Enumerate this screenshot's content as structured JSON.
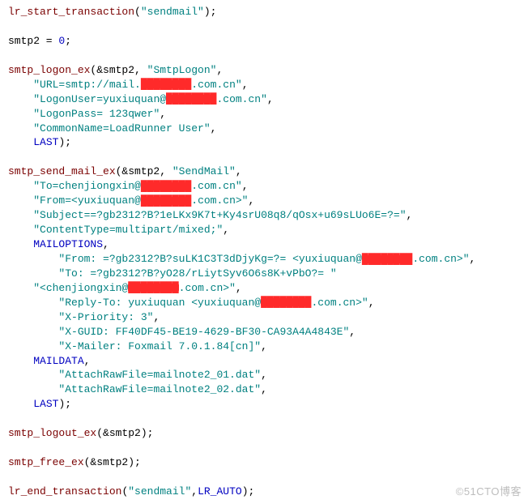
{
  "watermark": "©51CTO博客",
  "redacted": "████████",
  "code": {
    "l1_fn": "lr_start_transaction",
    "l1_str": "\"sendmail\"",
    "l3_lhs": "smtp2 = ",
    "l3_num": "0",
    "l5_fn": "smtp_logon_ex",
    "l5_args": "(&smtp2, ",
    "l5_str": "\"SmtpLogon\"",
    "l6_a": "\"URL=smtp://mail.",
    "l6_b": ".com.cn\"",
    "l7_a": "\"LogonUser=yuxiuquan@",
    "l7_b": ".com.cn\"",
    "l8": "\"LogonPass= 123qwer\"",
    "l9": "\"CommonName=LoadRunner User\"",
    "l10_kw": "LAST",
    "l12_fn": "smtp_send_mail_ex",
    "l12_args": "(&smtp2, ",
    "l12_str": "\"SendMail\"",
    "l13_a": "\"To=chenjiongxin@",
    "l13_b": ".com.cn\"",
    "l14_a": "\"From=<yuxiuquan@",
    "l14_b": ".com.cn>\"",
    "l15": "\"Subject==?gb2312?B?1eLKx9K7t+Ky4srU08q8/qOsx+u69sLUo6E=?=\"",
    "l16": "\"ContentType=multipart/mixed;\"",
    "l17_kw": "MAILOPTIONS",
    "l18_a": "\"From: =?gb2312?B?suLK1C3T3dDjyKg=?= <yuxiuquan@",
    "l18_b": ".com.cn>\"",
    "l19": "\"To: =?gb2312?B?yO28/rLiytSyv6O6s8K+vPbO?= \"",
    "l20_a": "\"<chenjiongxin@",
    "l20_b": ".com.cn>\"",
    "l21_a": "\"Reply-To: yuxiuquan <yuxiuquan@",
    "l21_b": ".com.cn>\"",
    "l22": "\"X-Priority: 3\"",
    "l23": "\"X-GUID: FF40DF45-BE19-4629-BF30-CA93A4A4843E\"",
    "l24": "\"X-Mailer: Foxmail 7.0.1.84[cn]\"",
    "l25_kw": "MAILDATA",
    "l26": "\"AttachRawFile=mailnote2_01.dat\"",
    "l27": "\"AttachRawFile=mailnote2_02.dat\"",
    "l28_kw": "LAST",
    "l30_fn": "smtp_logout_ex",
    "l30_args": "(&smtp2);",
    "l32_fn": "smtp_free_ex",
    "l32_args": "(&smtp2);",
    "l34_fn": "lr_end_transaction",
    "l34_str": "\"sendmail\"",
    "l34_kw": "LR_AUTO"
  }
}
